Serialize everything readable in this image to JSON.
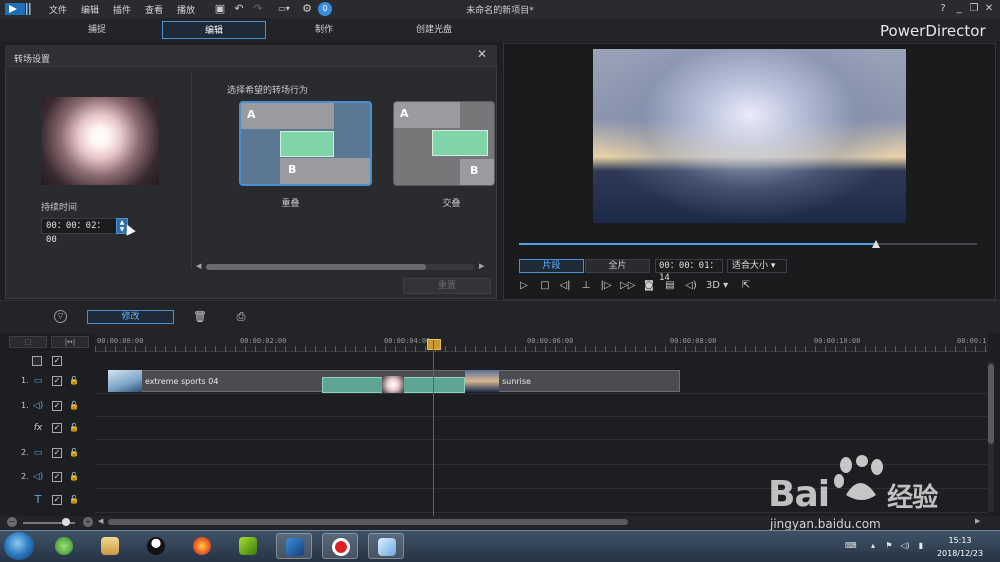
{
  "menu": [
    "文件",
    "编辑",
    "插件",
    "查看",
    "播放"
  ],
  "app_title": "未命名的新项目*",
  "brand": "PowerDirector",
  "mode_tabs": [
    "捕捉",
    "编辑",
    "制作",
    "创建光盘"
  ],
  "active_mode": "编辑",
  "toolbar_badge": "0",
  "transition": {
    "title": "转场设置",
    "duration_label": "持续时间",
    "duration_value": "00：00：02：00",
    "behavior_label": "选择希望的转场行为",
    "options": [
      {
        "label": "重叠",
        "a": "A",
        "b": "B",
        "selected": true
      },
      {
        "label": "交叠",
        "a": "A",
        "b": "B",
        "selected": false
      }
    ],
    "apply_label": "重置"
  },
  "preview": {
    "tab_clip": "片段",
    "tab_movie": "全片",
    "timecode": "00：00：01：14",
    "fit": "适合大小",
    "mode_3d": "3D",
    "seek_progress": 0.78
  },
  "tools": {
    "modify": "修改"
  },
  "timeline": {
    "ruler": [
      "00:00:00:00",
      "00:00:02:00",
      "00:00:04:00",
      "00:00:06:00",
      "00:00:08:00",
      "00:00:10:00",
      "00:00:1"
    ],
    "tracks": [
      {
        "num": "1.",
        "kind": "video"
      },
      {
        "num": "1.",
        "kind": "audio"
      },
      {
        "num": "",
        "kind": "fx"
      },
      {
        "num": "2.",
        "kind": "video"
      },
      {
        "num": "2.",
        "kind": "audio"
      },
      {
        "num": "",
        "kind": "title"
      }
    ],
    "clips": [
      {
        "name": "extreme sports 04"
      },
      {
        "name": "sunrise"
      }
    ],
    "fx_label": "fx",
    "title_label": "T"
  },
  "taskbar": {
    "time": "15:13",
    "date": "2018/12/23"
  },
  "watermark": {
    "text": "Bai",
    "cn": "经验",
    "url": "jingyan.baidu.com"
  },
  "colors": {
    "accent": "#4a8fd0",
    "playhead": "#d8302a",
    "transition_clip": "#5fa596"
  }
}
